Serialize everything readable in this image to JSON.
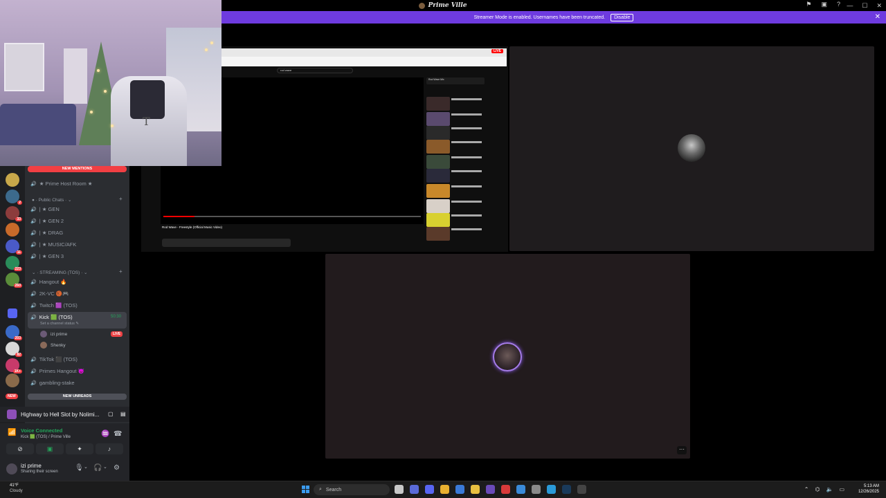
{
  "window": {
    "app_title": "Prime Ville",
    "icons": [
      "flag-icon",
      "screen-icon",
      "help-icon"
    ],
    "controls": [
      "minimize",
      "maximize",
      "close"
    ]
  },
  "banner": {
    "message": "Streamer Mode is enabled. Usernames have been truncated.",
    "button_label": "Disable",
    "color": "#6e3bdf"
  },
  "sidebar": {
    "new_mentions": "NEW MENTIONS",
    "new_unreads": "NEW UNREADS",
    "new_pill": "NEW",
    "server_badges": [
      "2",
      "33",
      "11",
      "223",
      "260",
      "203",
      "82",
      "1K+"
    ],
    "host_room": "★ Prime Host Room ★",
    "categories": {
      "public": "Public Chats",
      "streaming": "STREAMING (TOS)"
    },
    "public_channels": [
      "| ★ GEN",
      "| ★ GEN 2",
      "| ★ DRAG",
      "| ★ MUSIC/AFK",
      "| ★ GEN 3"
    ],
    "streaming_channels": {
      "hangout": "Hangout 🔥",
      "twok": "2K-VC 🏀🎮",
      "twitch": "Twitch 🟪 (TOS)",
      "kick": "Kick 🟩 (TOS)",
      "kick_status": "Set a channel status ✎",
      "kick_timer": "50:30",
      "members": [
        "izi prime",
        "Shenky"
      ],
      "live_label": "LIVE",
      "tiktok": "TikTok ⬛ (TOS)",
      "primes_hangout": "Primes Hangout 😈",
      "gambling": "gambling-stake"
    }
  },
  "activity": {
    "title": "Highway to Hell Slot by Nolimi..."
  },
  "voice": {
    "status": "Voice Connected",
    "channel": "Kick 🟩 (TOS) / Prime Ville"
  },
  "user": {
    "name": "izi prime",
    "status": "Sharing their screen"
  },
  "youtube": {
    "live_tag": "LIVE",
    "search_query": "rod wave",
    "video_title": "Rod Wave - Freestyle (Official Music Video)",
    "progress": 0.12,
    "queue_header": "Rod Wave Mix"
  },
  "taskbar": {
    "temperature": "41°F",
    "weather_condition": "Cloudy",
    "search_placeholder": "Search",
    "time": "5:13 AM",
    "date": "12/26/2025"
  }
}
